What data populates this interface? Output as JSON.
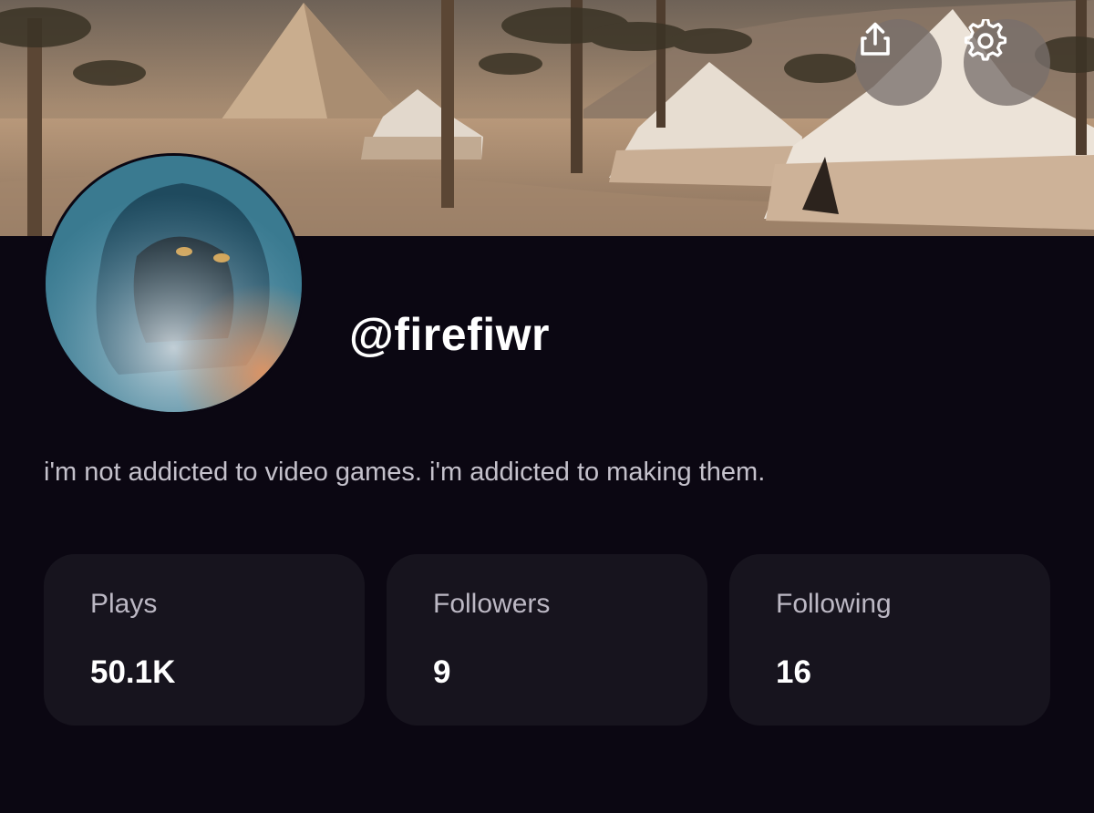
{
  "header": {
    "share_icon": "share-icon",
    "settings_icon": "gear-icon"
  },
  "profile": {
    "username": "@firefiwr",
    "bio": "i'm not addicted to video games. i'm addicted to making them."
  },
  "stats": [
    {
      "label": "Plays",
      "value": "50.1K"
    },
    {
      "label": "Followers",
      "value": "9"
    },
    {
      "label": "Following",
      "value": "16"
    }
  ],
  "colors": {
    "background": "#0b0712",
    "card": "#17141e",
    "text_primary": "#ffffff",
    "text_secondary": "#bcb8c4"
  }
}
